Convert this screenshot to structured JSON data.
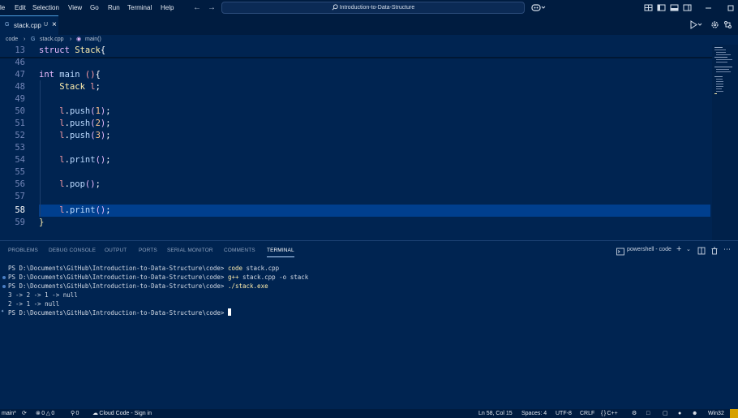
{
  "titlebar": {
    "menu": [
      "le",
      "Edit",
      "Selection",
      "View",
      "Go",
      "Run",
      "Terminal",
      "Help"
    ],
    "search_text": "Introduction-to-Data-Structure"
  },
  "tabs": [
    {
      "label": "stack.cpp",
      "modified": "U"
    }
  ],
  "breadcrumb": {
    "folder": "code",
    "file": "stack.cpp",
    "symbol": "main()"
  },
  "editor": {
    "lines": [
      {
        "number": "13",
        "kind": "struct",
        "text": "struct Stack{"
      },
      {
        "number": "46",
        "kind": "blank",
        "text": ""
      },
      {
        "number": "47",
        "kind": "main",
        "text": "int main (){"
      },
      {
        "number": "48",
        "kind": "decl",
        "text": "Stack l;"
      },
      {
        "number": "49",
        "kind": "blank",
        "text": ""
      },
      {
        "number": "50",
        "kind": "call",
        "text": "l.push(1);"
      },
      {
        "number": "51",
        "kind": "call",
        "text": "l.push(2);"
      },
      {
        "number": "52",
        "kind": "call",
        "text": "l.push(3);"
      },
      {
        "number": "53",
        "kind": "blank",
        "text": ""
      },
      {
        "number": "54",
        "kind": "call",
        "text": "l.print();"
      },
      {
        "number": "55",
        "kind": "blank",
        "text": ""
      },
      {
        "number": "56",
        "kind": "call",
        "text": "l.pop();"
      },
      {
        "number": "57",
        "kind": "blank",
        "text": ""
      },
      {
        "number": "58",
        "kind": "call",
        "text": "l.print();"
      },
      {
        "number": "59",
        "kind": "close",
        "text": "}"
      }
    ]
  },
  "panel": {
    "tabs": [
      "PROBLEMS",
      "DEBUG CONSOLE",
      "OUTPUT",
      "PORTS",
      "SERIAL MONITOR",
      "COMMENTS",
      "TERMINAL"
    ],
    "active_tab": "TERMINAL",
    "shell_label": "powershell - code"
  },
  "terminal": {
    "prompt": "PS D:\\Documents\\GitHub\\Introduction-to-Data-Structure\\code>",
    "lines": [
      {
        "prompt": "PS D:\\Documents\\GitHub\\Introduction-to-Data-Structure\\code>",
        "cmd": "code",
        "args": " stack.cpp"
      },
      {
        "prompt": "PS D:\\Documents\\GitHub\\Introduction-to-Data-Structure\\code>",
        "cmd": "g++",
        "args": " stack.cpp -o stack"
      },
      {
        "prompt": "PS D:\\Documents\\GitHub\\Introduction-to-Data-Structure\\code>",
        "cmd": "./stack.exe",
        "args": ""
      },
      {
        "output": "3 -> 2 -> 1 -> null"
      },
      {
        "output": "2 -> 1 -> null"
      }
    ]
  },
  "statusbar": {
    "branch": "main*",
    "errors": "0",
    "warnings": "0",
    "ports": "0",
    "cloud": "Cloud Code - Sign in",
    "position": "Ln 58, Col 15",
    "spaces": "Spaces: 4",
    "encoding": "UTF-8",
    "eol": "CRLF",
    "language": "C++",
    "platform": "Win32"
  },
  "colors": {
    "background": "#002451",
    "chrome": "#001c40",
    "accent": "#bbdaff",
    "current_line": "#003f8e",
    "notification": "#d6a100"
  }
}
